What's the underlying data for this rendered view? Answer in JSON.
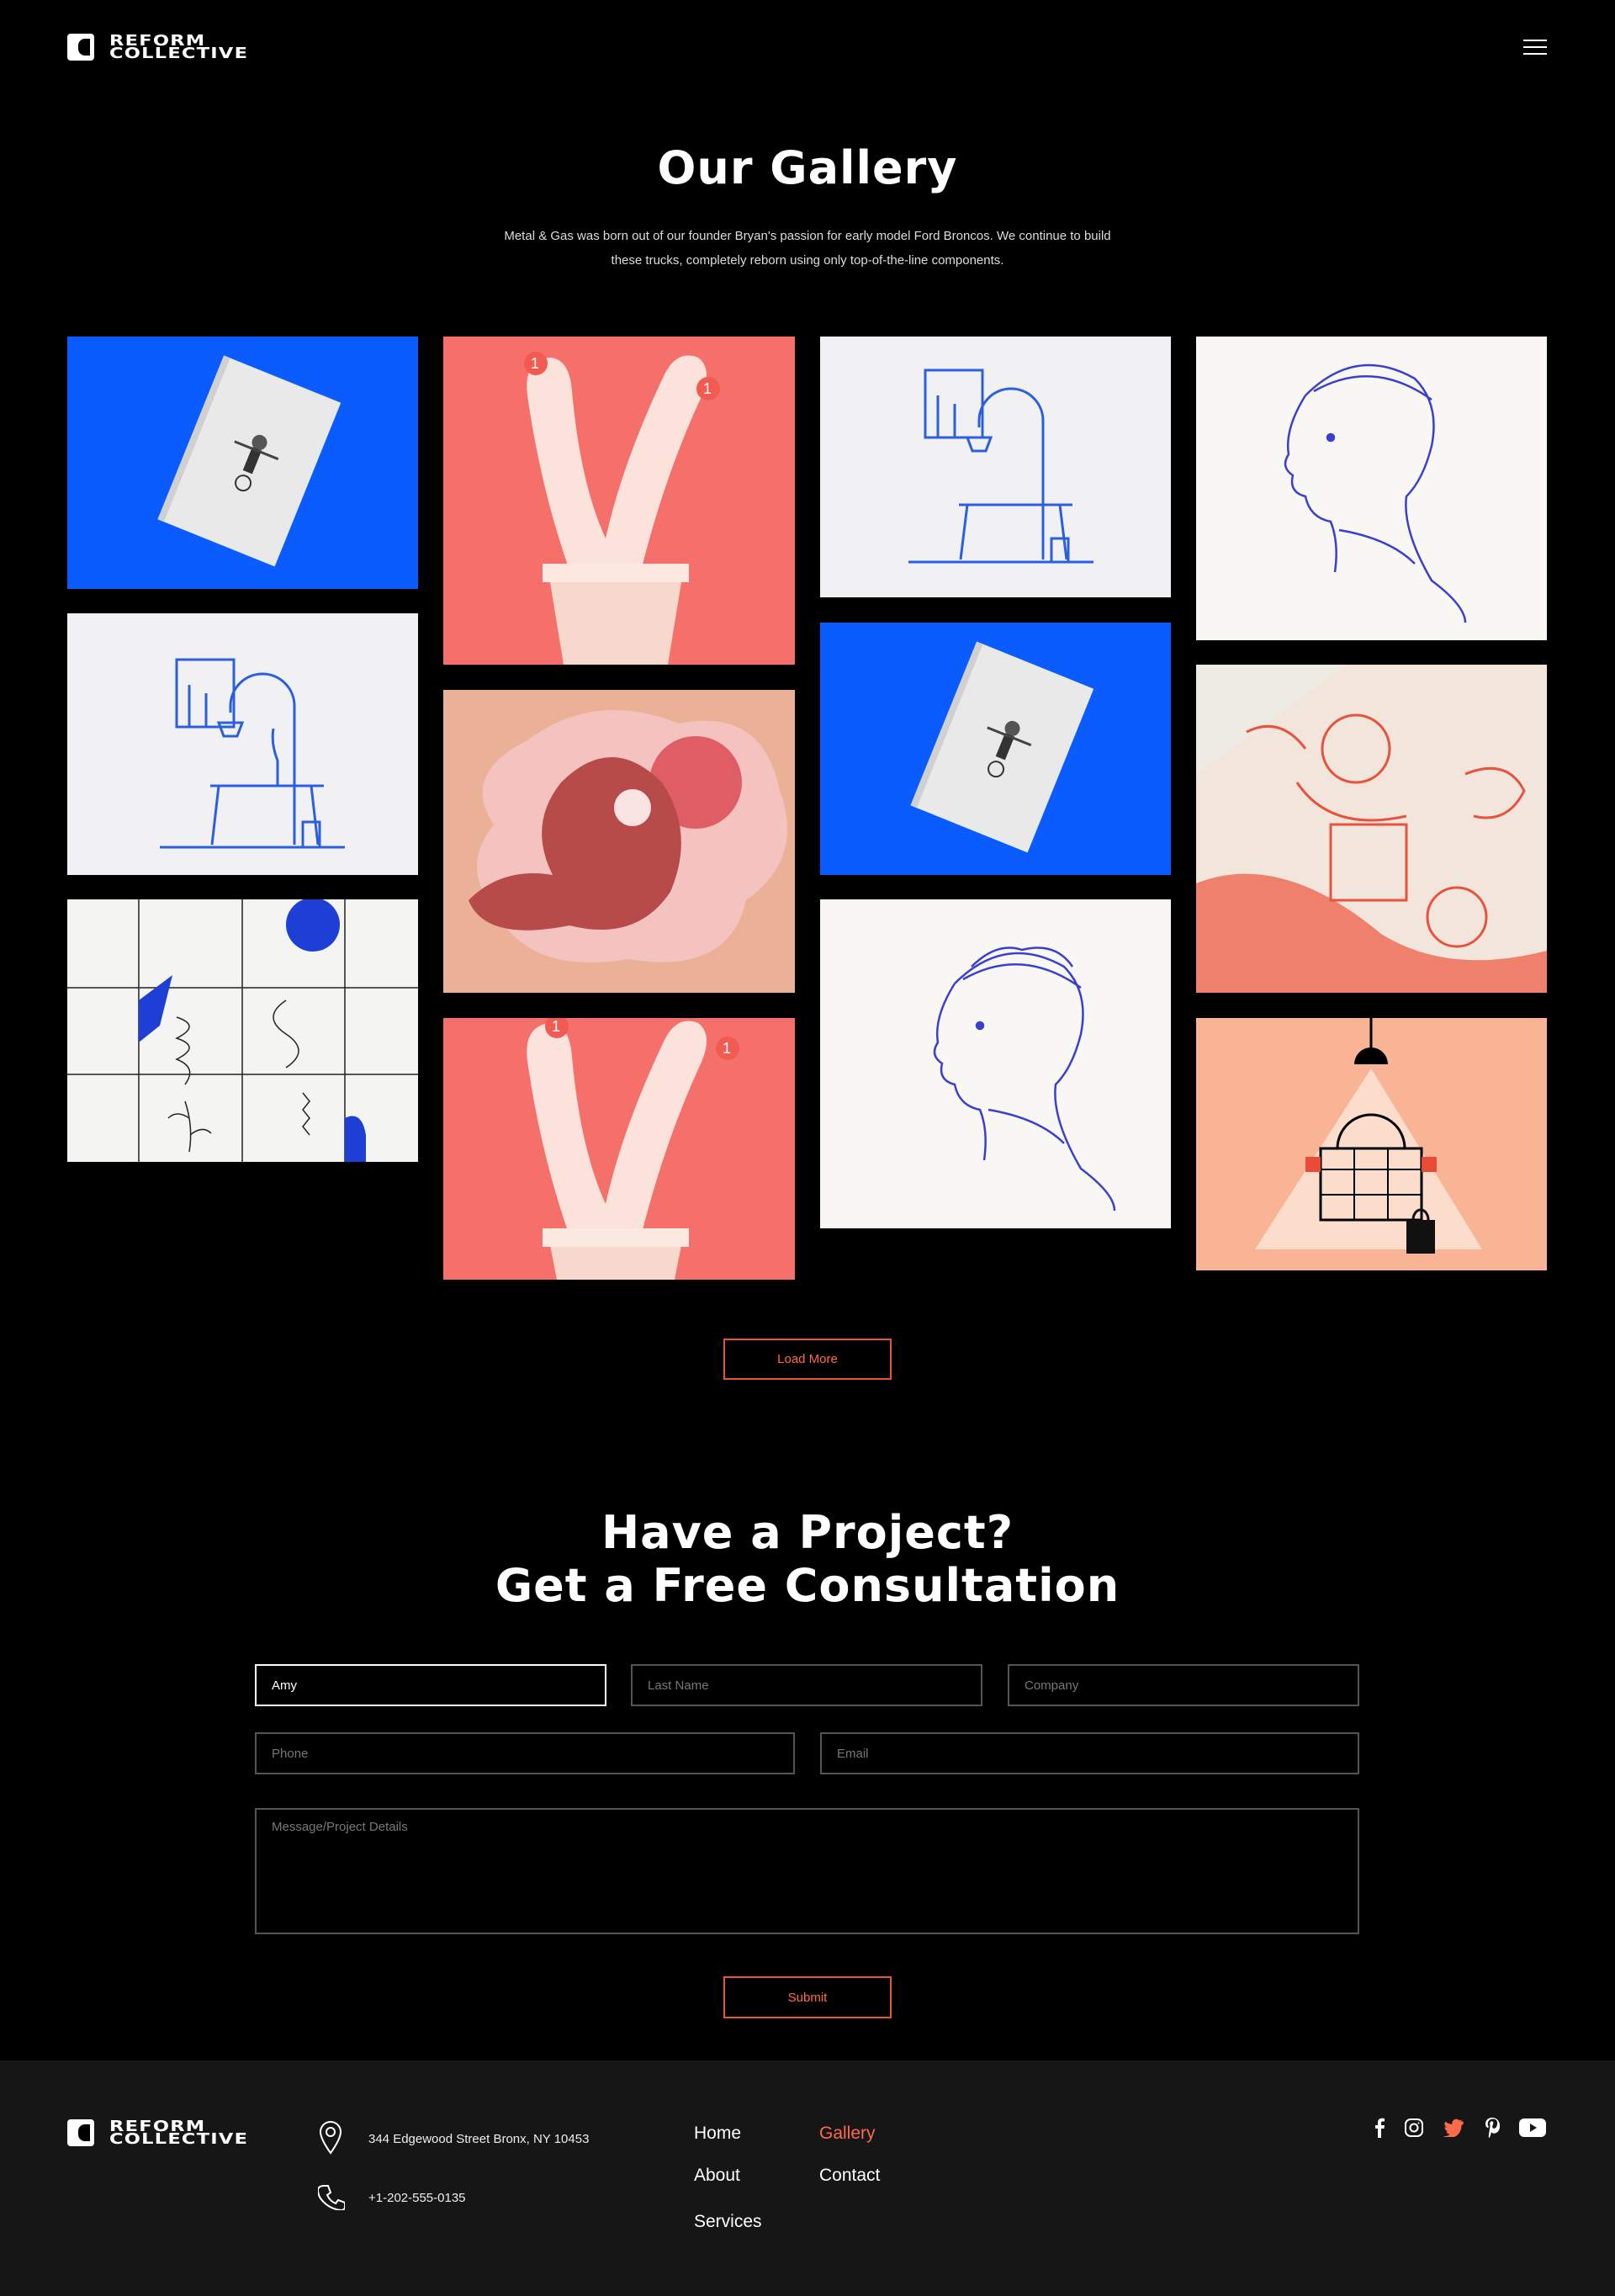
{
  "brand": {
    "line1": "REFORM",
    "line2": "COLLECTIVE",
    "logo_icon": "half-circle-logo-icon"
  },
  "header": {
    "menu_icon": "hamburger-menu-icon"
  },
  "gallery": {
    "title": "Our Gallery",
    "intro": "Metal & Gas was born out of our founder Bryan's passion for early model Ford Broncos. We continue to build these trucks, completely reborn using only top-of-the-line components.",
    "load_more_label": "Load More",
    "colors": {
      "blue": "#0a5cff",
      "coral": "#f5706b",
      "peach": "#f9b395",
      "cream": "#f5f4f0",
      "accent": "#ff6a4d"
    }
  },
  "contact": {
    "title_line1": "Have a Project?",
    "title_line2": "Get a Free Consultation",
    "first_name_value": "Amy",
    "last_name_placeholder": "Last Name",
    "company_placeholder": "Company",
    "phone_placeholder": "Phone",
    "email_placeholder": "Email",
    "message_placeholder": "Message/Project Details",
    "submit_label": "Submit"
  },
  "footer": {
    "address": "344 Edgewood Street Bronx, NY 10453",
    "phone": "+1-202-555-0135",
    "nav": {
      "home": "Home",
      "gallery": "Gallery",
      "about": "About",
      "contact": "Contact",
      "services": "Services"
    },
    "active_nav": "Gallery",
    "social_icons": [
      "facebook-icon",
      "instagram-icon",
      "twitter-icon",
      "pinterest-icon",
      "youtube-icon"
    ]
  }
}
